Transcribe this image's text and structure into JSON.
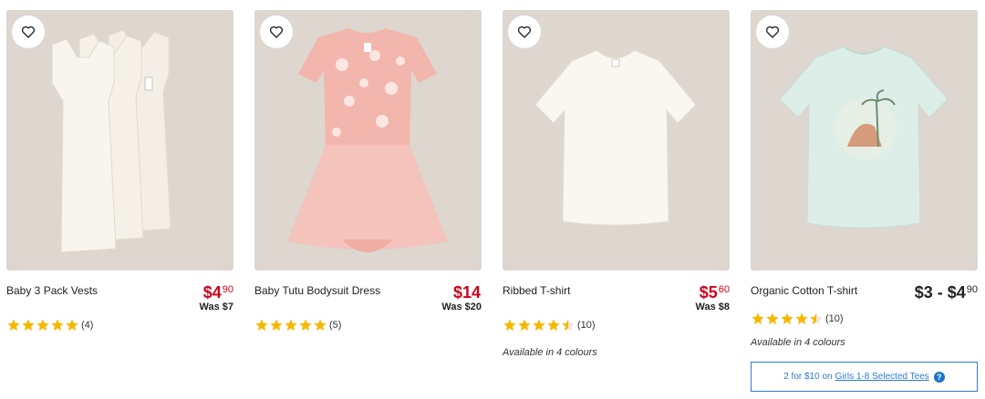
{
  "colors": {
    "sale_red": "#d0021b",
    "star_gold": "#f5b800",
    "promo_blue": "#2b7cd3",
    "card_bg": "#ddd7d0"
  },
  "icons": {
    "favourite": "heart-outline-icon",
    "rating": "star-icon",
    "help": "question-circle-icon"
  },
  "products": [
    {
      "name": "Baby 3 Pack Vests",
      "price_dollars": "$4",
      "price_cents": "90",
      "was": "Was $7",
      "rating": 5,
      "review_count": "(4)"
    },
    {
      "name": "Baby Tutu Bodysuit Dress",
      "price_dollars": "$14",
      "price_cents": "",
      "was": "Was $20",
      "rating": 5,
      "review_count": "(5)"
    },
    {
      "name": "Ribbed T-shirt",
      "price_dollars": "$5",
      "price_cents": "60",
      "was": "Was $8",
      "rating": 4.5,
      "review_count": "(10)",
      "colours_note": "Available in 4 colours"
    },
    {
      "name": "Organic Cotton T-shirt",
      "price_dollars": "$3 - $4",
      "price_cents": "90",
      "rating": 4.5,
      "review_count": "(10)",
      "colours_note": "Available in 4 colours",
      "promo": {
        "prefix": "2 for $10 on",
        "link": "Girls 1-8 Selected Tees",
        "help_glyph": "?"
      }
    }
  ]
}
